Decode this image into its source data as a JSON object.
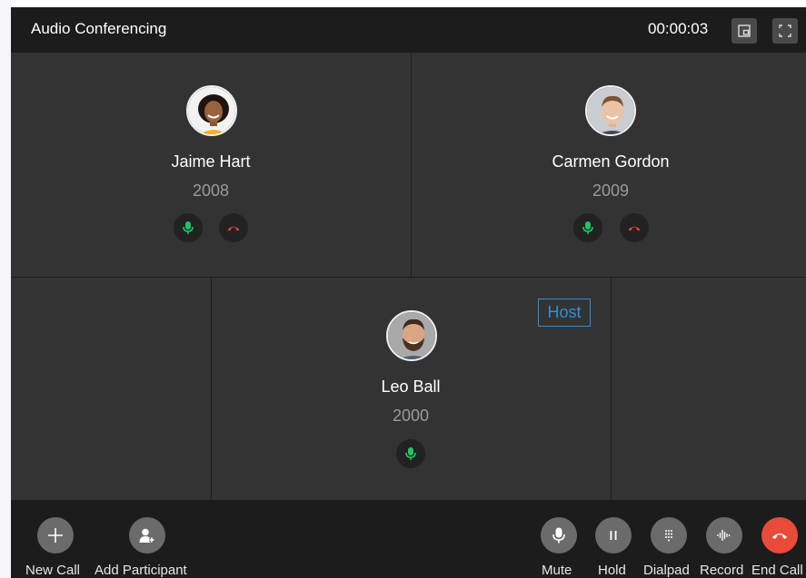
{
  "window": {
    "title": "Audio Conferencing",
    "timer": "00:00:03"
  },
  "titlebar_buttons": [
    {
      "name": "picture-in-picture-icon"
    },
    {
      "name": "fullscreen-icon"
    }
  ],
  "participants": [
    {
      "name": "Jaime Hart",
      "extension": "2008",
      "avatar": "avatar-woman",
      "mic": "mic-icon",
      "hangup": "hangup-icon"
    },
    {
      "name": "Carmen Gordon",
      "extension": "2009",
      "avatar": "avatar-man",
      "mic": "mic-icon",
      "hangup": "hangup-icon"
    },
    {
      "name": "Leo Ball",
      "extension": "2000",
      "avatar": "avatar-bearded-man",
      "mic": "mic-icon",
      "role_badge": "Host"
    }
  ],
  "footer": {
    "left": [
      {
        "label": "New Call",
        "icon": "plus-icon"
      },
      {
        "label": "Add Participant",
        "icon": "add-user-icon"
      }
    ],
    "right": [
      {
        "label": "Mute",
        "icon": "mic-icon"
      },
      {
        "label": "Hold",
        "icon": "pause-icon"
      },
      {
        "label": "Dialpad",
        "icon": "dialpad-icon"
      },
      {
        "label": "Record",
        "icon": "waveform-icon"
      },
      {
        "label": "End Call",
        "icon": "hangup-icon"
      }
    ]
  },
  "colors": {
    "mic_green": "#22c55e",
    "hangup_red": "#e84b3a",
    "host_blue": "#2f8fd8",
    "panel_bg": "#333333",
    "bar_bg": "#1c1c1c"
  }
}
